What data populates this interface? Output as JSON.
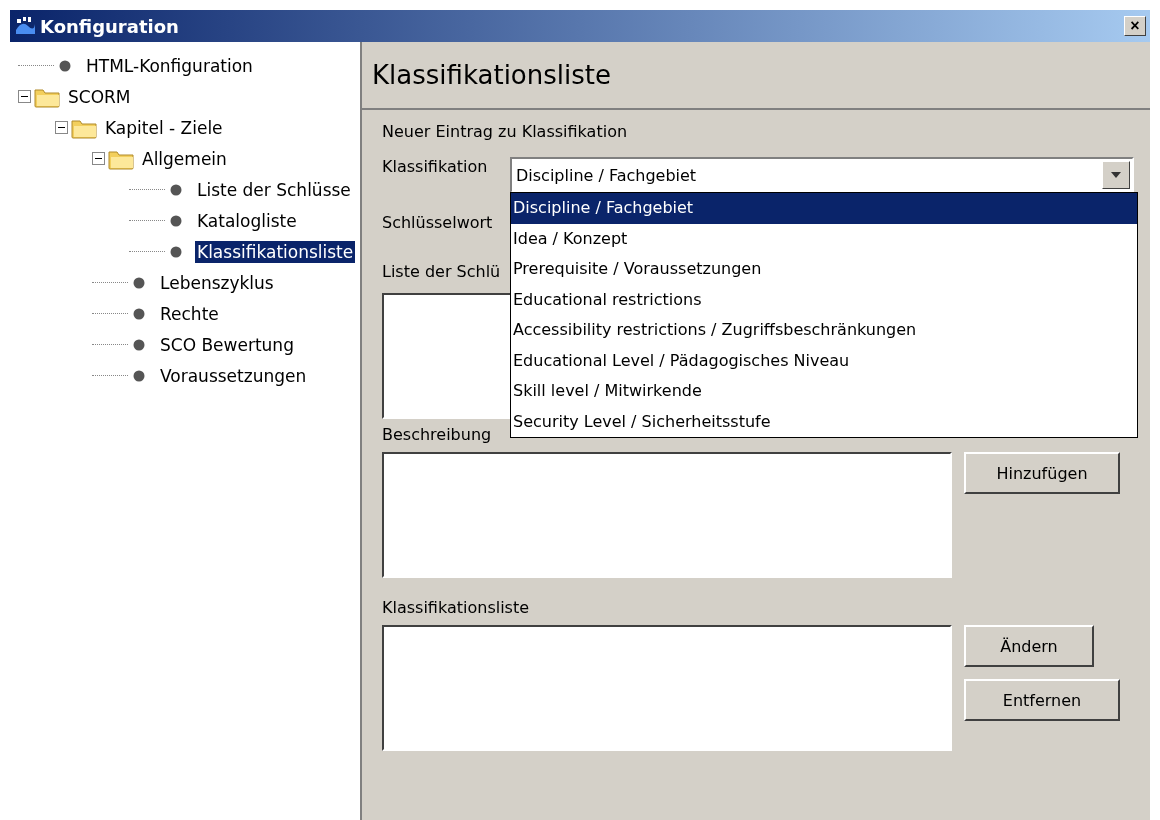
{
  "window": {
    "title": "Konfiguration",
    "close_label": "×"
  },
  "tree": [
    {
      "label": "HTML-Konfiguration",
      "kind": "leaf",
      "selected": false
    },
    {
      "label": "SCORM",
      "kind": "folder",
      "expanded": true,
      "selected": false,
      "children": [
        {
          "label": "Kapitel - Ziele",
          "kind": "folder",
          "expanded": true,
          "selected": false,
          "children": [
            {
              "label": "Allgemein",
              "kind": "folder",
              "expanded": true,
              "selected": false,
              "children": [
                {
                  "label": "Liste der Schlüsse",
                  "kind": "leaf",
                  "selected": false
                },
                {
                  "label": "Katalogliste",
                  "kind": "leaf",
                  "selected": false
                },
                {
                  "label": "Klassifikationsliste",
                  "kind": "leaf",
                  "selected": true
                }
              ]
            },
            {
              "label": "Lebenszyklus",
              "kind": "leaf",
              "selected": false
            },
            {
              "label": "Rechte",
              "kind": "leaf",
              "selected": false
            },
            {
              "label": "SCO Bewertung",
              "kind": "leaf",
              "selected": false
            },
            {
              "label": "Voraussetzungen",
              "kind": "leaf",
              "selected": false
            }
          ]
        }
      ]
    }
  ],
  "page_title": "Klassifikationsliste",
  "section_label": "Neuer Eintrag zu Klassifikation",
  "classification": {
    "label": "Klassifikation",
    "value": "Discipline / Fachgebiet",
    "options": [
      {
        "label": "Discipline / Fachgebiet",
        "selected": true
      },
      {
        "label": "Idea / Konzept",
        "selected": false
      },
      {
        "label": "Prerequisite / Voraussetzungen",
        "selected": false
      },
      {
        "label": "Educational restrictions",
        "selected": false
      },
      {
        "label": "Accessibility restrictions / Zugriffsbeschränkungen",
        "selected": false
      },
      {
        "label": "Educational Level / Pädagogisches Niveau",
        "selected": false
      },
      {
        "label": "Skill level / Mitwirkende",
        "selected": false
      },
      {
        "label": "Security Level  / Sicherheitsstufe",
        "selected": false
      }
    ]
  },
  "keyword_label": "Schlüsselwort",
  "keyword_list_label": "Liste der Schlü",
  "description_label": "Beschreibung",
  "add_button": "Hinzufügen",
  "list_label": "Klassifikationsliste",
  "change_button": "Ändern",
  "remove_button": "Entfernen"
}
